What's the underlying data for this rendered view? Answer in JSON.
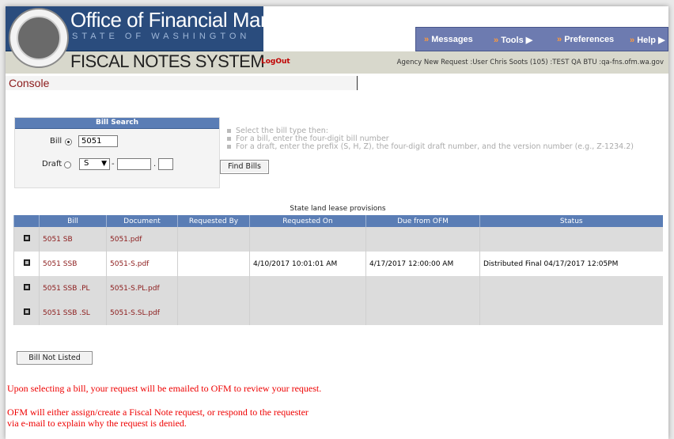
{
  "header": {
    "org_title": "Office of Financial Management",
    "org_subtitle": "STATE OF WASHINGTON",
    "system_title": "FISCAL NOTES SYSTEM",
    "logout_label": "LogOut",
    "agency_info": "Agency New Request :User Chris Soots (105) :TEST QA BTU :qa-fns.ofm.wa.gov",
    "menu": [
      {
        "label": "Messages",
        "prefix": "»"
      },
      {
        "label": "Tools",
        "prefix": "»"
      },
      {
        "label": "Preferences",
        "prefix": "»"
      },
      {
        "label": "Help",
        "prefix": "»"
      }
    ]
  },
  "console_label": "Console",
  "bill_search": {
    "title": "Bill Search",
    "bill_label": "Bill",
    "bill_value": "5051",
    "draft_label": "Draft",
    "draft_prefix": "S",
    "dash": "-",
    "dot": ".",
    "find_button": "Find Bills"
  },
  "instructions": [
    "Select the bill type then:",
    "For a bill, enter the four-digit bill number",
    "For a draft, enter the prefix (S, H, Z), the four-digit draft number, and the version number (e.g., Z-1234.2)"
  ],
  "results": {
    "caption": "State land lease provisions",
    "columns": [
      "",
      "Bill",
      "Document",
      "Requested By",
      "Requested On",
      "Due from OFM",
      "Status"
    ],
    "rows": [
      {
        "bill": "5051 SB",
        "document": "5051.pdf",
        "requested_by": "",
        "requested_on": "",
        "due": "",
        "status": ""
      },
      {
        "bill": "5051 SSB",
        "document": "5051-S.pdf",
        "requested_by": "",
        "requested_on": "4/10/2017 10:01:01 AM",
        "due": "4/17/2017 12:00:00 AM",
        "status": "Distributed Final 04/17/2017 12:05PM"
      },
      {
        "bill": "5051 SSB .PL",
        "document": "5051-S.PL.pdf",
        "requested_by": "",
        "requested_on": "",
        "due": "",
        "status": ""
      },
      {
        "bill": "5051 SSB .SL",
        "document": "5051-S.SL.pdf",
        "requested_by": "",
        "requested_on": "",
        "due": "",
        "status": ""
      }
    ]
  },
  "bill_not_listed_button": "Bill Not Listed",
  "notices": [
    "Upon selecting a bill, your request will be emailed to OFM to review your request.",
    "OFM will either assign/create a Fiscal Note request, or respond to the requester",
    "via e-mail to explain why the request is denied."
  ],
  "colors": {
    "header_blue": "#2a4c7d",
    "menu_bg": "#6d7bb0",
    "grid_header": "#5a7db5",
    "link": "#8b1a1a",
    "notice": "#ee0000"
  }
}
